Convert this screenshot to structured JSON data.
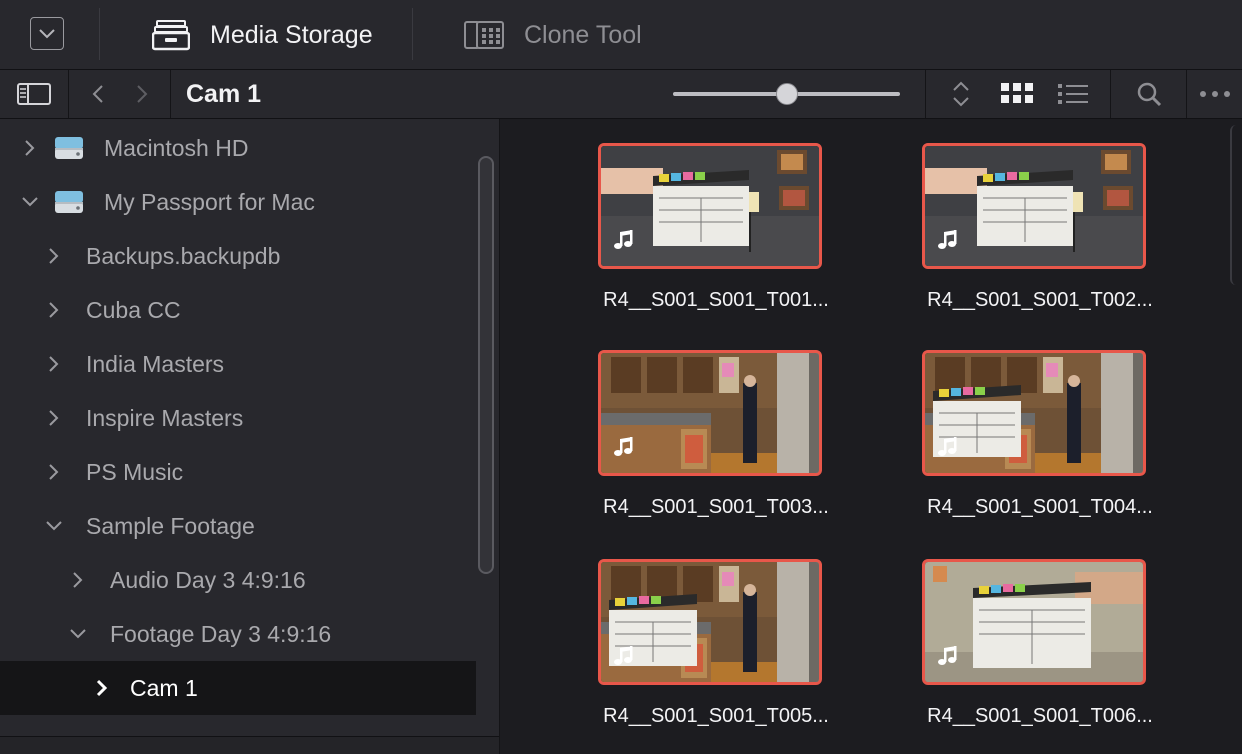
{
  "topbar": {
    "tabs": [
      {
        "label": "Media Storage",
        "icon": "media-storage-icon",
        "active": true
      },
      {
        "label": "Clone Tool",
        "icon": "clone-tool-icon",
        "active": false
      }
    ]
  },
  "toolbar": {
    "path_title": "Cam 1",
    "zoom_slider_level": 0.5
  },
  "sidebar": {
    "items": [
      {
        "label": "Macintosh HD",
        "depth": 0,
        "expanded": false,
        "drive": true
      },
      {
        "label": "My Passport for Mac",
        "depth": 0,
        "expanded": true,
        "drive": true
      },
      {
        "label": "Backups.backupdb",
        "depth": 1,
        "expanded": false
      },
      {
        "label": "Cuba CC",
        "depth": 1,
        "expanded": false
      },
      {
        "label": "India Masters",
        "depth": 1,
        "expanded": false
      },
      {
        "label": "Inspire Masters",
        "depth": 1,
        "expanded": false
      },
      {
        "label": "PS Music",
        "depth": 1,
        "expanded": false
      },
      {
        "label": "Sample Footage",
        "depth": 1,
        "expanded": true
      },
      {
        "label": "Audio Day 3 4:9:16",
        "depth": 2,
        "expanded": false
      },
      {
        "label": "Footage Day 3 4:9:16",
        "depth": 2,
        "expanded": true
      },
      {
        "label": "Cam 1",
        "depth": 3,
        "expanded": false,
        "selected": true
      }
    ]
  },
  "clips": [
    {
      "name": "R4__S001_S001_T001...",
      "scene": "slate-dark"
    },
    {
      "name": "R4__S001_S001_T002...",
      "scene": "slate-dark"
    },
    {
      "name": "R4__S001_S001_T003...",
      "scene": "kitchen"
    },
    {
      "name": "R4__S001_S001_T004...",
      "scene": "kitchen-slate"
    },
    {
      "name": "R4__S001_S001_T005...",
      "scene": "kitchen-slate"
    },
    {
      "name": "R4__S001_S001_T006...",
      "scene": "slate-bright"
    }
  ],
  "colors": {
    "accent": "#e8574a",
    "selected_row": "#151517",
    "panel": "#28282d"
  }
}
